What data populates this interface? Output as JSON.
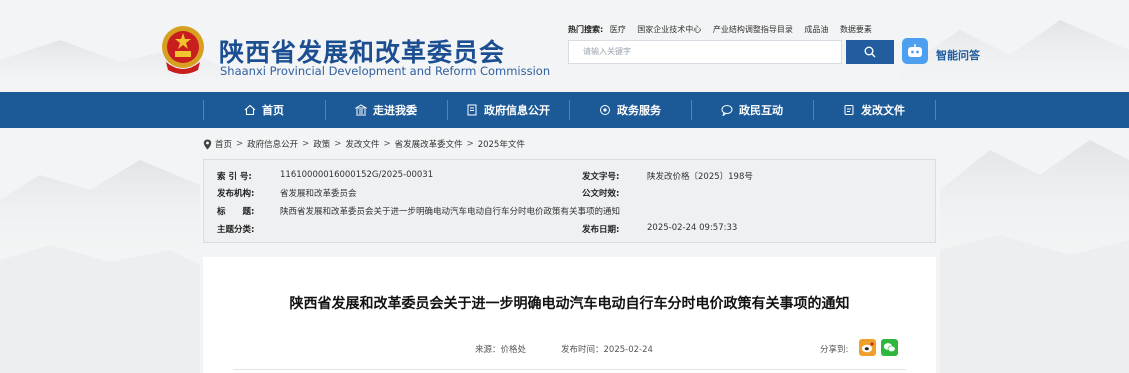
{
  "header": {
    "title": "陕西省发展和改革委员会",
    "subtitle": "Shaanxi Provincial Development and Reform Commission",
    "hot_search_label": "热门搜索:",
    "hot_keywords": [
      "医疗",
      "国家企业技术中心",
      "产业结构调整指导目录",
      "成品油",
      "数据要素"
    ],
    "search_placeholder": "请输入关键字",
    "ai_label": "智能问答"
  },
  "nav": {
    "items": [
      {
        "label": "首页",
        "icon": "home-icon"
      },
      {
        "label": "走进我委",
        "icon": "building-icon"
      },
      {
        "label": "政府信息公开",
        "icon": "document-icon"
      },
      {
        "label": "政务服务",
        "icon": "service-icon"
      },
      {
        "label": "政民互动",
        "icon": "chat-icon"
      },
      {
        "label": "发改文件",
        "icon": "file-icon"
      }
    ]
  },
  "breadcrumb": [
    "首页",
    "政府信息公开",
    "政策",
    "发改文件",
    "省发展改革委文件",
    "2025年文件"
  ],
  "info": {
    "index_label": "索 引 号:",
    "index_value": "11610000016000152G/2025-00031",
    "doc_no_label": "发文字号:",
    "doc_no_value": "陕发改价格〔2025〕198号",
    "publisher_label": "发布机构:",
    "publisher_value": "省发展和改革委员会",
    "effective_label": "公文时效:",
    "effective_value": "",
    "title_label": "标　　题:",
    "title_value": "陕西省发展和改革委员会关于进一步明确电动汽车电动自行车分时电价政策有关事项的通知",
    "topic_label": "主题分类:",
    "topic_value": "",
    "date_label": "发布日期:",
    "date_value": "2025-02-24 09:57:33"
  },
  "article": {
    "title": "陕西省发展和改革委员会关于进一步明确电动汽车电动自行车分时电价政策有关事项的通知",
    "source": "来源：价格处",
    "publish_time": "发布时间：2025-02-24",
    "share_label": "分享到:"
  },
  "colors": {
    "brand_blue": "#1c5a97",
    "title_blue": "#1b4f91",
    "page_bg": "#f3f4f5"
  }
}
